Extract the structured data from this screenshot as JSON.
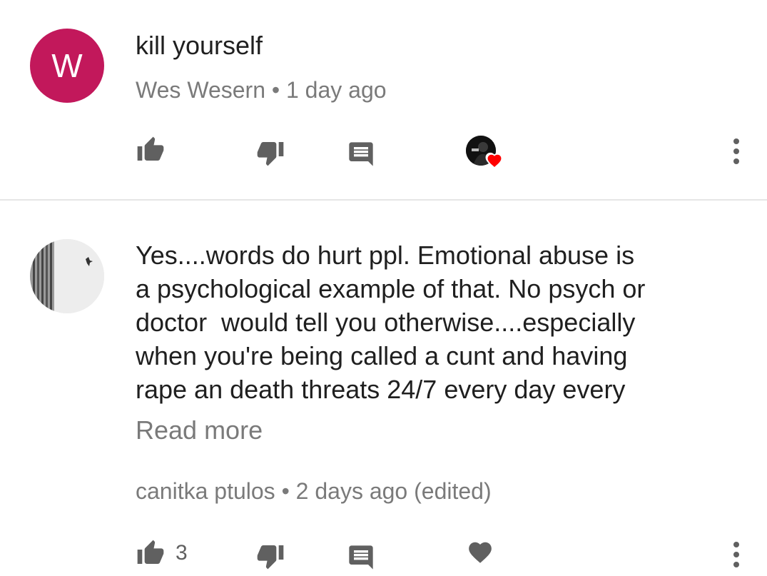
{
  "comments": [
    {
      "avatar_letter": "W",
      "avatar_color": "#c2185b",
      "text": "kill yourself",
      "author": "Wes Wesern",
      "time": "1 day ago",
      "like_count": "",
      "creator_hearted": true,
      "icons": [
        "thumb-up-icon",
        "thumb-down-icon",
        "reply-icon",
        "creator-heart-badge",
        "more-vert-icon"
      ]
    },
    {
      "text": "Yes....words do hurt ppl. Emotional abuse is\na psychological example of that. No psych or\ndoctor  would tell you otherwise....especially\nwhen you're being called a cunt and having\nrape an death threats 24/7 every day every",
      "read_more": "Read more",
      "author": "canitka ptulos",
      "time": "2 days ago (edited)",
      "like_count": "3",
      "creator_hearted": false,
      "icons": [
        "thumb-up-icon",
        "thumb-down-icon",
        "reply-icon",
        "heart-icon",
        "more-vert-icon"
      ]
    }
  ],
  "meta_separator": " • ",
  "colors": {
    "text": "#1f1f1f",
    "secondary": "#7a7a7a",
    "icon": "#606060",
    "heart_red": "#ff0000",
    "divider": "#e6e6e6"
  }
}
